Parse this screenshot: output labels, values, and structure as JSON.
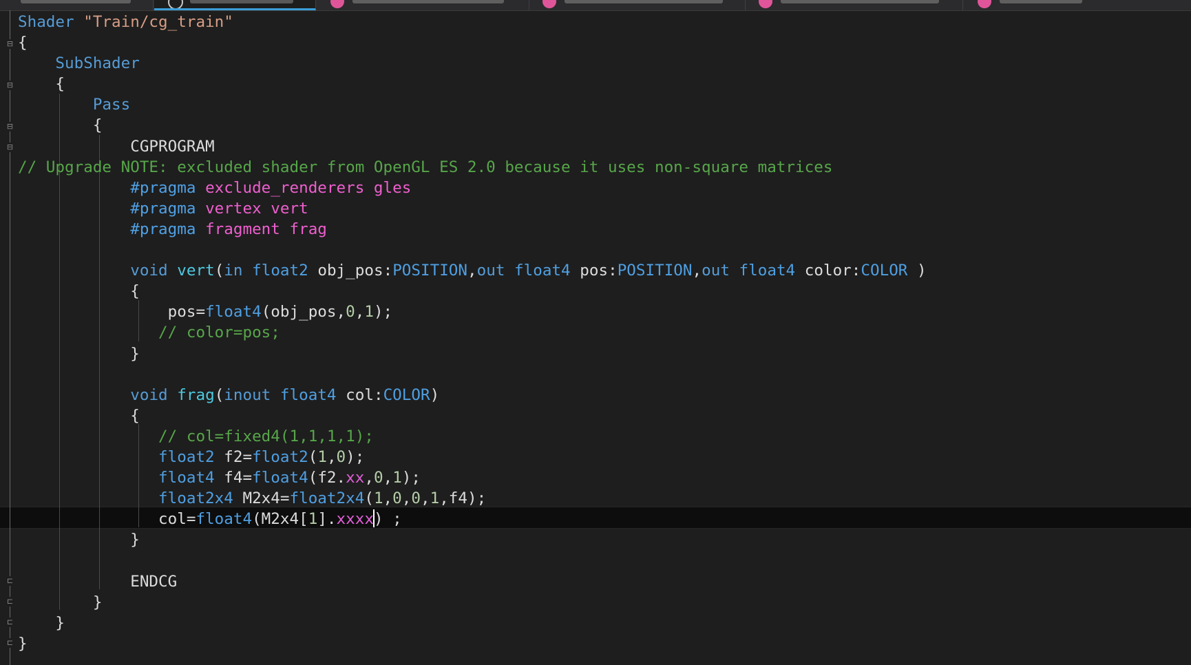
{
  "editor": {
    "tabs": [
      {
        "label": "",
        "active": false,
        "icon": "none"
      },
      {
        "label": "cg_train",
        "active": true,
        "icon": "csharp-file-icon"
      },
      {
        "label": "",
        "active": false,
        "icon": "magenta-file-icon"
      },
      {
        "label": "",
        "active": false,
        "icon": "magenta-file-icon"
      },
      {
        "label": "",
        "active": false,
        "icon": "magenta-file-icon"
      },
      {
        "label": "",
        "active": false,
        "icon": "magenta-file-icon"
      }
    ],
    "colors": {
      "background": "#1e1e1e",
      "keyword": "#569cd6",
      "string": "#d69d85",
      "comment": "#57a64a",
      "preprocessor": "#4fa1e6",
      "pragma_arg": "#ee5fce",
      "function": "#4ec9e0",
      "number": "#b5cea8",
      "swizzle": "#e05ed8",
      "active_tab_accent": "#3b9ed8"
    },
    "current_line_index": 24,
    "lines": [
      [
        [
          "kw",
          "Shader "
        ],
        [
          "str",
          "\"Train/cg_train\""
        ]
      ],
      [
        [
          "pl",
          "{"
        ]
      ],
      [
        [
          "pl",
          "    "
        ],
        [
          "kw",
          "SubShader"
        ]
      ],
      [
        [
          "pl",
          "    {"
        ]
      ],
      [
        [
          "pl",
          "        "
        ],
        [
          "kw",
          "Pass"
        ]
      ],
      [
        [
          "pl",
          "        {"
        ]
      ],
      [
        [
          "pl",
          "            CGPROGRAM"
        ]
      ],
      [
        [
          "cm",
          "// Upgrade NOTE: excluded shader from OpenGL ES 2.0 because it uses non-square matrices"
        ]
      ],
      [
        [
          "pl",
          "            "
        ],
        [
          "pp",
          "#pragma"
        ],
        [
          "pl",
          " "
        ],
        [
          "pr",
          "exclude_renderers gles"
        ]
      ],
      [
        [
          "pl",
          "            "
        ],
        [
          "pp",
          "#pragma"
        ],
        [
          "pl",
          " "
        ],
        [
          "pr",
          "vertex vert"
        ]
      ],
      [
        [
          "pl",
          "            "
        ],
        [
          "pp",
          "#pragma"
        ],
        [
          "pl",
          " "
        ],
        [
          "pr",
          "fragment frag"
        ]
      ],
      [
        [
          "pl",
          ""
        ]
      ],
      [
        [
          "pl",
          "            "
        ],
        [
          "kw",
          "void"
        ],
        [
          "pl",
          " "
        ],
        [
          "fn",
          "vert"
        ],
        [
          "pl",
          "("
        ],
        [
          "kw",
          "in"
        ],
        [
          "pl",
          " "
        ],
        [
          "ty",
          "float2"
        ],
        [
          "pl",
          " obj_pos:"
        ],
        [
          "sem",
          "POSITION"
        ],
        [
          "pl",
          ","
        ],
        [
          "kw",
          "out"
        ],
        [
          "pl",
          " "
        ],
        [
          "ty",
          "float4"
        ],
        [
          "pl",
          " pos:"
        ],
        [
          "sem",
          "POSITION"
        ],
        [
          "pl",
          ","
        ],
        [
          "kw",
          "out"
        ],
        [
          "pl",
          " "
        ],
        [
          "ty",
          "float4"
        ],
        [
          "pl",
          " color:"
        ],
        [
          "sem",
          "COLOR"
        ],
        [
          "pl",
          " )"
        ]
      ],
      [
        [
          "pl",
          "            {"
        ]
      ],
      [
        [
          "pl",
          "                pos="
        ],
        [
          "ty",
          "float4"
        ],
        [
          "pl",
          "(obj_pos,"
        ],
        [
          "num",
          "0"
        ],
        [
          "pl",
          ","
        ],
        [
          "num",
          "1"
        ],
        [
          "pl",
          ");"
        ]
      ],
      [
        [
          "pl",
          "               "
        ],
        [
          "cm",
          "// color=pos;"
        ]
      ],
      [
        [
          "pl",
          "            }"
        ]
      ],
      [
        [
          "pl",
          ""
        ]
      ],
      [
        [
          "pl",
          "            "
        ],
        [
          "kw",
          "void"
        ],
        [
          "pl",
          " "
        ],
        [
          "fn",
          "frag"
        ],
        [
          "pl",
          "("
        ],
        [
          "kw",
          "inout"
        ],
        [
          "pl",
          " "
        ],
        [
          "ty",
          "float4"
        ],
        [
          "pl",
          " col:"
        ],
        [
          "sem",
          "COLOR"
        ],
        [
          "pl",
          ")"
        ]
      ],
      [
        [
          "pl",
          "            {"
        ]
      ],
      [
        [
          "pl",
          "               "
        ],
        [
          "cm",
          "// col=fixed4(1,1,1,1);"
        ]
      ],
      [
        [
          "pl",
          "               "
        ],
        [
          "ty",
          "float2"
        ],
        [
          "pl",
          " f2="
        ],
        [
          "ty",
          "float2"
        ],
        [
          "pl",
          "("
        ],
        [
          "num",
          "1"
        ],
        [
          "pl",
          ","
        ],
        [
          "num",
          "0"
        ],
        [
          "pl",
          ");"
        ]
      ],
      [
        [
          "pl",
          "               "
        ],
        [
          "ty",
          "float4"
        ],
        [
          "pl",
          " f4="
        ],
        [
          "ty",
          "float4"
        ],
        [
          "pl",
          "(f2."
        ],
        [
          "sw",
          "xx"
        ],
        [
          "pl",
          ","
        ],
        [
          "num",
          "0"
        ],
        [
          "pl",
          ","
        ],
        [
          "num",
          "1"
        ],
        [
          "pl",
          ");"
        ]
      ],
      [
        [
          "pl",
          "               "
        ],
        [
          "ty",
          "float2x4"
        ],
        [
          "pl",
          " M2x4="
        ],
        [
          "ty",
          "float2x4"
        ],
        [
          "pl",
          "("
        ],
        [
          "num",
          "1"
        ],
        [
          "pl",
          ","
        ],
        [
          "num",
          "0"
        ],
        [
          "pl",
          ","
        ],
        [
          "num",
          "0"
        ],
        [
          "pl",
          ","
        ],
        [
          "num",
          "1"
        ],
        [
          "pl",
          ",f4);"
        ]
      ],
      [
        [
          "pl",
          "               col="
        ],
        [
          "ty",
          "float4"
        ],
        [
          "pl",
          "(M2x4["
        ],
        [
          "num",
          "1"
        ],
        [
          "pl",
          "]."
        ],
        [
          "sw",
          "xxxx"
        ],
        [
          "caret",
          ""
        ],
        [
          "pl",
          ") ;"
        ]
      ],
      [
        [
          "pl",
          "            }"
        ]
      ],
      [
        [
          "pl",
          ""
        ]
      ],
      [
        [
          "pl",
          "            ENDCG"
        ]
      ],
      [
        [
          "pl",
          "        }"
        ]
      ],
      [
        [
          "pl",
          "    }"
        ]
      ],
      [
        [
          "pl",
          "}"
        ]
      ]
    ]
  }
}
